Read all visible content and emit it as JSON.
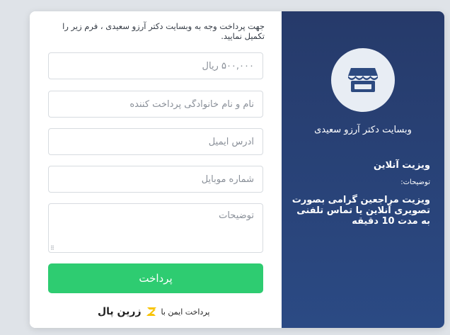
{
  "intro_text": "جهت پرداخت وجه به وبسایت دکتر آرزو سعیدی ، فرم زیر را تکمیل نمایید.",
  "form": {
    "amount_placeholder": "۵۰۰,۰۰۰ ریال",
    "name_placeholder": "نام و نام خانوادگی پرداخت کننده",
    "email_placeholder": "آدرس ایمیل",
    "mobile_placeholder": "شماره موبایل",
    "description_placeholder": "توضیحات",
    "pay_button_label": "پرداخت"
  },
  "footer": {
    "label": "پرداخت ایمن با",
    "brand": "زرین پال",
    "brand_color": "#f8c300"
  },
  "sidebar": {
    "icon": "store-icon",
    "site_name": "وبسایت دکتر آرزو سعیدی",
    "product_title": "ویزیت آنلاین",
    "description_label": "توضیحات:",
    "description_text": "ویزیت مراجعین گرامی بصورت تصویری آنلاین یا تماس تلفنی به مدت 10 دقیقه",
    "background_color": "#263a6a"
  },
  "colors": {
    "accent_green": "#2ecc71",
    "store_icon": "#2d4a80"
  }
}
